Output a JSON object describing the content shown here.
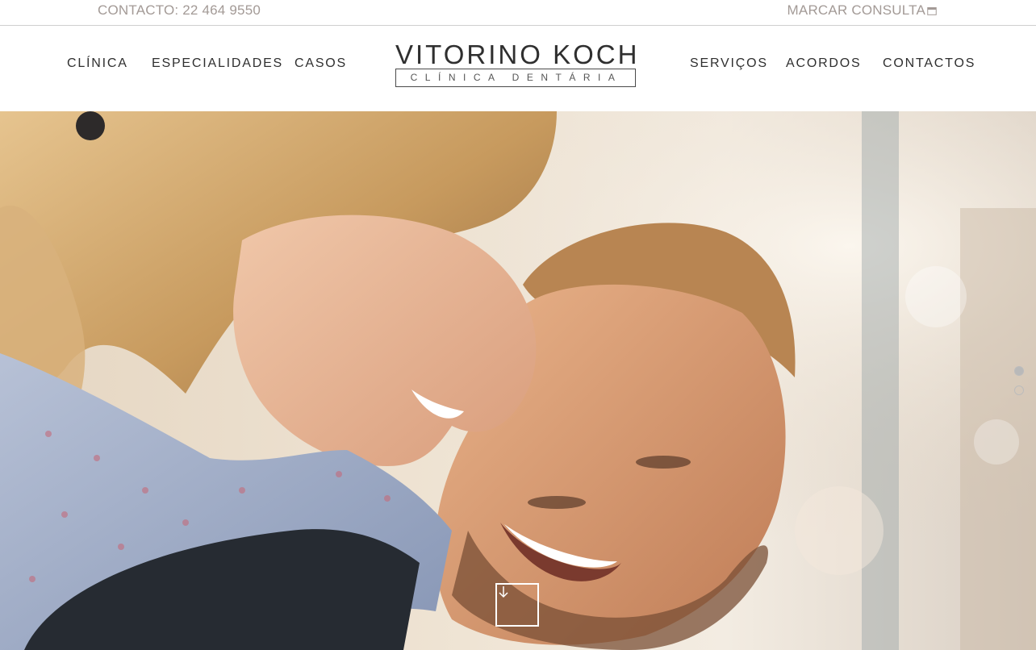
{
  "topbar": {
    "contact": "CONTACTO: 22 464 9550",
    "booking": "MARCAR CONSULTA"
  },
  "nav": {
    "left": [
      "CLÍNICA",
      "ESPECIALIDADES",
      "CASOS"
    ],
    "right": [
      "SERVIÇOS",
      "ACORDOS",
      "CONTACTOS"
    ]
  },
  "logo": {
    "title": "VITORINO KOCH",
    "subtitle": "CLÍNICA DENTÁRIA"
  },
  "hero": {
    "image": "smiling-couple-photo",
    "slides_total": 2,
    "active_slide": 1
  },
  "icons": {
    "booking": "calendar-icon",
    "scroll": "arrow-down-icon"
  },
  "colors": {
    "utility_text": "#a39a96",
    "nav_text": "#2f2f2f",
    "dot_active": "#b9b9b9"
  }
}
